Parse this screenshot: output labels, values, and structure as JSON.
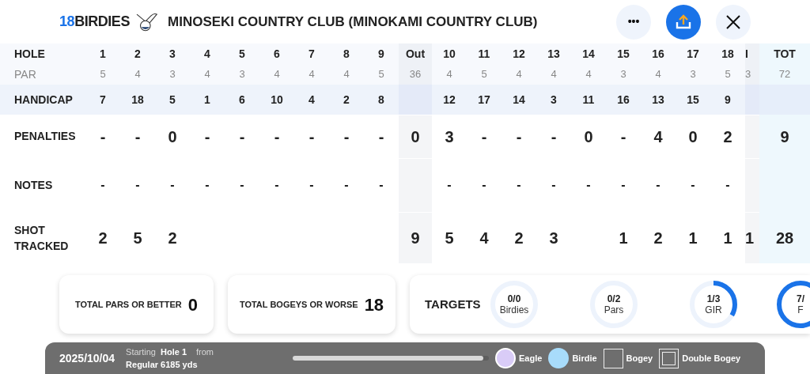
{
  "header": {
    "logo": {
      "number": "18",
      "word": "BIRDIES"
    },
    "title": "MINOSEKI COUNTRY CLUB (MINOKAMI COUNTRY CLUB)",
    "actions": [
      {
        "kind": "more",
        "label": "•••"
      },
      {
        "kind": "share"
      },
      {
        "kind": "close"
      }
    ]
  },
  "scorecard": {
    "rows": [
      {
        "kind": "hole",
        "label": "HOLE",
        "front": [
          "1",
          "2",
          "3",
          "4",
          "5",
          "6",
          "7",
          "8",
          "9"
        ],
        "out": "Out",
        "back": [
          "10",
          "11",
          "12",
          "13",
          "14",
          "15",
          "16",
          "17",
          "18"
        ],
        "in": "I",
        "total": "TOT"
      },
      {
        "kind": "par",
        "label": "PAR",
        "front": [
          "5",
          "4",
          "3",
          "4",
          "3",
          "4",
          "4",
          "4",
          "5"
        ],
        "out": "36",
        "back": [
          "4",
          "5",
          "4",
          "4",
          "4",
          "3",
          "4",
          "3",
          "5"
        ],
        "in": "3",
        "total": "72"
      },
      {
        "kind": "handicap",
        "label": "HANDICAP",
        "front": [
          "7",
          "18",
          "5",
          "1",
          "6",
          "10",
          "4",
          "2",
          "8"
        ],
        "back": [
          "12",
          "17",
          "14",
          "3",
          "11",
          "16",
          "13",
          "15",
          "9"
        ]
      },
      {
        "kind": "penalties",
        "label": "PENALTIES",
        "front": [
          "-",
          "-",
          "0",
          "-",
          "-",
          "-",
          "-",
          "-",
          "-"
        ],
        "out": "0",
        "back": [
          "3",
          "-",
          "-",
          "-",
          "0",
          "-",
          "4",
          "0",
          "2"
        ],
        "total": "9"
      },
      {
        "kind": "notes",
        "label": "NOTES",
        "front": [
          "-",
          "-",
          "-",
          "-",
          "-",
          "-",
          "-",
          "-",
          "-"
        ],
        "back": [
          "-",
          "-",
          "-",
          "-",
          "-",
          "-",
          "-",
          "-",
          "-"
        ]
      },
      {
        "kind": "shots",
        "label": "SHOT TRACKED",
        "front": [
          "2",
          "5",
          "2"
        ],
        "out": "9",
        "back": [
          "5",
          "4",
          "2",
          "3"
        ],
        "back_end": [
          "1",
          "2",
          "1",
          "1"
        ],
        "in": "1",
        "total": "28"
      }
    ]
  },
  "summary": [
    {
      "label": "TOTAL PARS OR BETTER",
      "value": "0"
    },
    {
      "label": "TOTAL BOGEYS OR WORSE",
      "value": "18"
    }
  ],
  "targets": {
    "title": "TARGETS",
    "rings": [
      {
        "value": "0/0",
        "label": "Birdies"
      },
      {
        "value": "0/2",
        "label": "Pars"
      },
      {
        "value": "1/3",
        "label": "GIR"
      },
      {
        "value": "7/",
        "label": "F"
      }
    ]
  },
  "footer": {
    "date": "2025/10/04",
    "starting": "Starting",
    "hole": "Hole 1",
    "from": "from",
    "tee": "Regular 6185 yds",
    "level": 0.97,
    "legend": [
      {
        "kind": "eagle",
        "label": "Eagle"
      },
      {
        "kind": "birdie",
        "label": "Birdie"
      },
      {
        "kind": "bogey",
        "label": "Bogey"
      },
      {
        "kind": "double",
        "label": "Double Bogey"
      }
    ]
  }
}
